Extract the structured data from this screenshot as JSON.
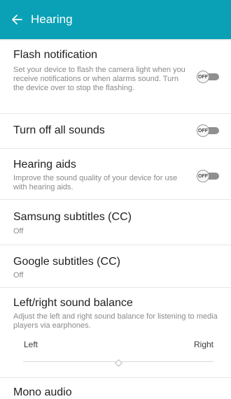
{
  "appbar": {
    "title": "Hearing",
    "back_icon": "arrow-left-icon",
    "color": "#0aa1b7"
  },
  "settings": {
    "flash": {
      "title": "Flash notification",
      "description": "Set your device to flash the camera light when you receive notifications or when alarms sound. Turn the device over to stop the flashing.",
      "toggle": "OFF"
    },
    "all_sounds": {
      "title": "Turn off all sounds",
      "toggle": "OFF"
    },
    "hearing_aids": {
      "title": "Hearing aids",
      "description": "Improve the sound quality of your device for use with hearing aids.",
      "toggle": "OFF"
    },
    "samsung_cc": {
      "title": "Samsung subtitles (CC)",
      "value": "Off"
    },
    "google_cc": {
      "title": "Google subtitles (CC)",
      "value": "Off"
    },
    "balance": {
      "title": "Left/right sound balance",
      "description": "Adjust the left and right sound balance for listening to media players via earphones.",
      "left_label": "Left",
      "right_label": "Right",
      "position": 0.5
    },
    "mono_audio": {
      "title": "Mono audio"
    }
  }
}
